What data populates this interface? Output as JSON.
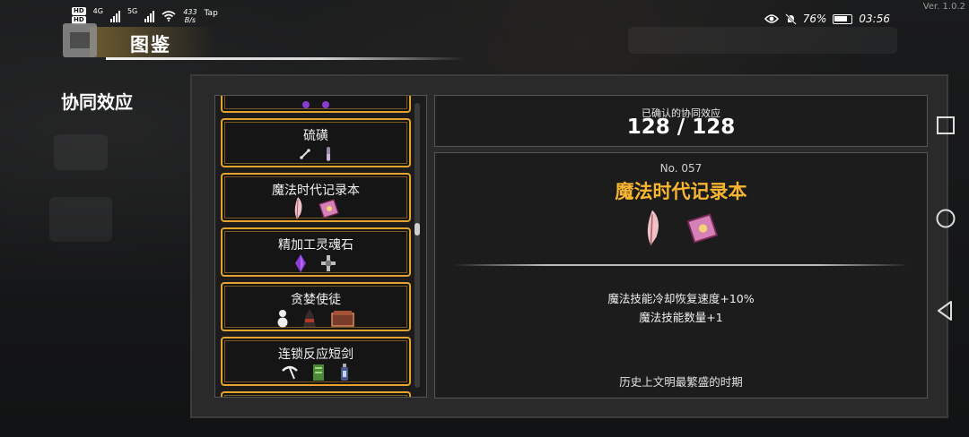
{
  "status_bar": {
    "hd1": "HD",
    "hd2": "HD",
    "net1": "4G",
    "net2": "5G",
    "speed": "433\nB/s",
    "tap": "Tap",
    "battery": "76%",
    "time": "03:56"
  },
  "version": "Ver. 1.0.2",
  "header": {
    "title": "图鉴"
  },
  "section_title": "协同效应",
  "list": {
    "items": [
      {
        "name": "硫磺",
        "icons": [
          "bone-icon",
          "vial-icon"
        ]
      },
      {
        "name": "魔法时代记录本",
        "icons": [
          "feather-icon",
          "spellbook-icon"
        ]
      },
      {
        "name": "精加工灵魂石",
        "icons": [
          "purple-gem-icon",
          "cross-relic-icon"
        ]
      },
      {
        "name": "贪婪使徒",
        "icons": [
          "snowman-icon",
          "dark-figure-icon",
          "treasure-chest-icon"
        ]
      },
      {
        "name": "连锁反应短剑",
        "icons": [
          "pickaxe-icon",
          "green-scroll-icon",
          "lantern-icon"
        ]
      }
    ]
  },
  "summary": {
    "label": "已确认的协同效应",
    "value": "128 / 128"
  },
  "detail": {
    "number": "No. 057",
    "title": "魔法时代记录本",
    "icons": [
      "feather-icon",
      "spellbook-icon"
    ],
    "effect1": "魔法技能冷却恢复速度+10%",
    "effect2": "魔法技能数量+1",
    "flavor": "历史上文明最繁盛的时期"
  },
  "colors": {
    "accent": "#f7b531",
    "card_border": "#e3a32c"
  }
}
